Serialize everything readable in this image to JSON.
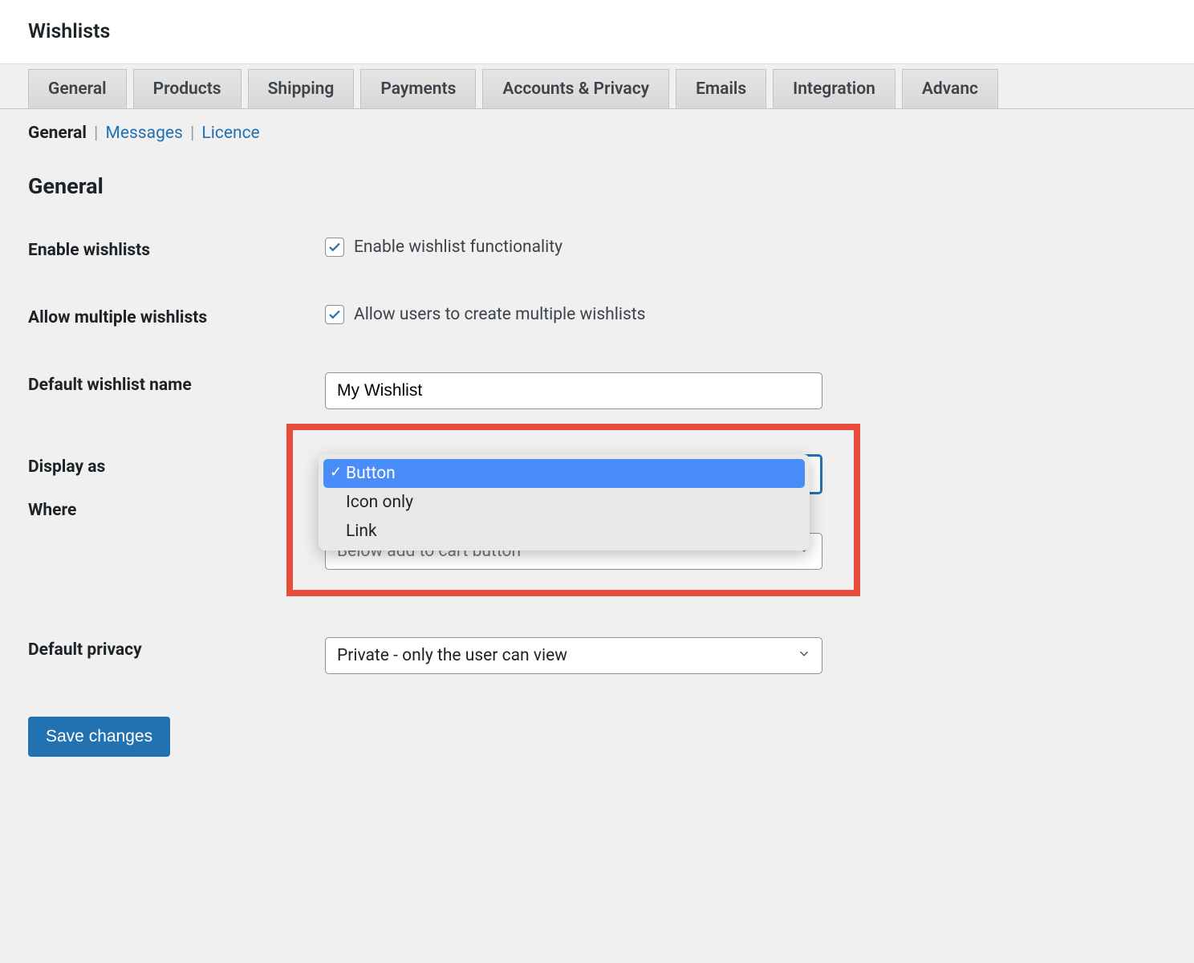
{
  "header": {
    "title": "Wishlists"
  },
  "tabs": [
    "General",
    "Products",
    "Shipping",
    "Payments",
    "Accounts & Privacy",
    "Emails",
    "Integration",
    "Advanc"
  ],
  "subtabs": {
    "active": "General",
    "links": [
      "Messages",
      "Licence"
    ]
  },
  "section_title": "General",
  "fields": {
    "enable": {
      "label": "Enable wishlists",
      "text": "Enable wishlist functionality",
      "checked": true
    },
    "multiple": {
      "label": "Allow multiple wishlists",
      "text": "Allow users to create multiple wishlists",
      "checked": true
    },
    "default_name": {
      "label": "Default wishlist name",
      "value": "My Wishlist"
    },
    "display_as": {
      "label": "Display as",
      "selected": "Button",
      "options": [
        "Button",
        "Icon only",
        "Link"
      ]
    },
    "where": {
      "label": "Where",
      "value": "Below add to cart button"
    },
    "privacy": {
      "label": "Default privacy",
      "value": "Private - only the user can view"
    }
  },
  "save_button": "Save changes"
}
